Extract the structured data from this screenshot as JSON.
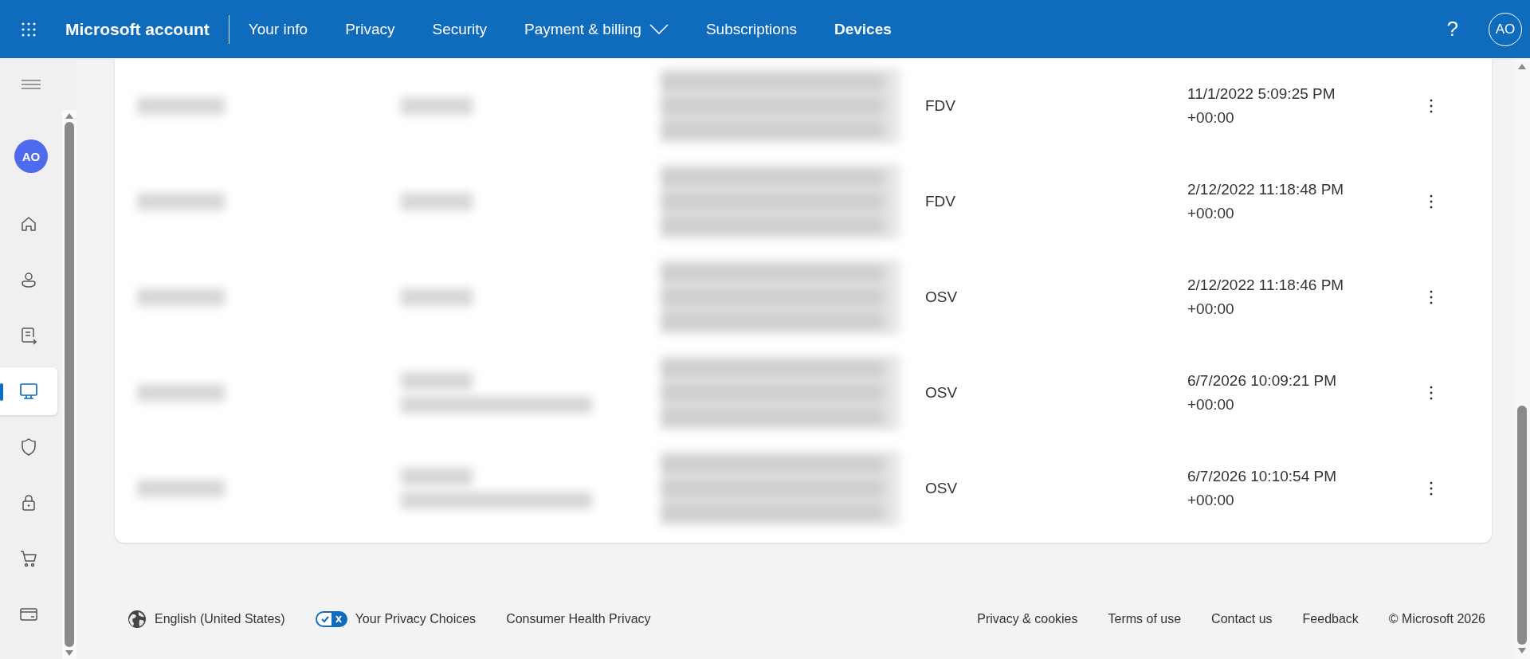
{
  "header": {
    "title": "Microsoft account",
    "nav": [
      {
        "label": "Your info",
        "selected": false
      },
      {
        "label": "Privacy",
        "selected": false
      },
      {
        "label": "Security",
        "selected": false
      },
      {
        "label": "Payment & billing",
        "selected": false,
        "kind": "dropdown"
      },
      {
        "label": "Subscriptions",
        "selected": false
      },
      {
        "label": "Devices",
        "selected": true
      }
    ],
    "help": "?",
    "avatar": "AO"
  },
  "sidebar": {
    "avatar": "AO",
    "items": [
      {
        "selected": false
      },
      {
        "selected": false
      },
      {
        "selected": false
      },
      {
        "selected": true
      },
      {
        "selected": false
      },
      {
        "selected": false
      },
      {
        "selected": false
      },
      {
        "selected": false
      }
    ]
  },
  "table": {
    "rows": [
      {
        "cells": [
          {
            "kind": "blurred"
          },
          {
            "kind": "blurred"
          },
          {
            "kind": "block"
          },
          {
            "kind": "text",
            "text": "FDV"
          },
          {
            "kind": "text",
            "text": "11/1/2022 5:09:25 PM +00:00"
          }
        ]
      },
      {
        "cells": [
          {
            "kind": "blurred"
          },
          {
            "kind": "blurred"
          },
          {
            "kind": "block"
          },
          {
            "kind": "text",
            "text": "FDV"
          },
          {
            "kind": "text",
            "text": "2/12/2022 11:18:48 PM +00:00"
          }
        ]
      },
      {
        "cells": [
          {
            "kind": "blurred"
          },
          {
            "kind": "blurred"
          },
          {
            "kind": "block"
          },
          {
            "kind": "text",
            "text": "OSV"
          },
          {
            "kind": "text",
            "text": "2/12/2022 11:18:46 PM +00:00"
          }
        ]
      },
      {
        "cells": [
          {
            "kind": "blurred"
          },
          {
            "kind": "double"
          },
          {
            "kind": "block"
          },
          {
            "kind": "text",
            "text": "OSV"
          },
          {
            "kind": "text",
            "text": "6/7/2026 10:09:21 PM +00:00"
          }
        ]
      },
      {
        "cells": [
          {
            "kind": "blurred"
          },
          {
            "kind": "double"
          },
          {
            "kind": "block"
          },
          {
            "kind": "text",
            "text": "OSV"
          },
          {
            "kind": "text",
            "text": "6/7/2026 10:10:54 PM +00:00"
          }
        ]
      }
    ]
  },
  "footer": {
    "language": "English (United States)",
    "left_links": [
      "Your Privacy Choices",
      "Consumer Health Privacy"
    ],
    "right_links": [
      "Privacy & cookies",
      "Terms of use",
      "Contact us",
      "Feedback"
    ],
    "copyright": "© Microsoft 2026"
  }
}
